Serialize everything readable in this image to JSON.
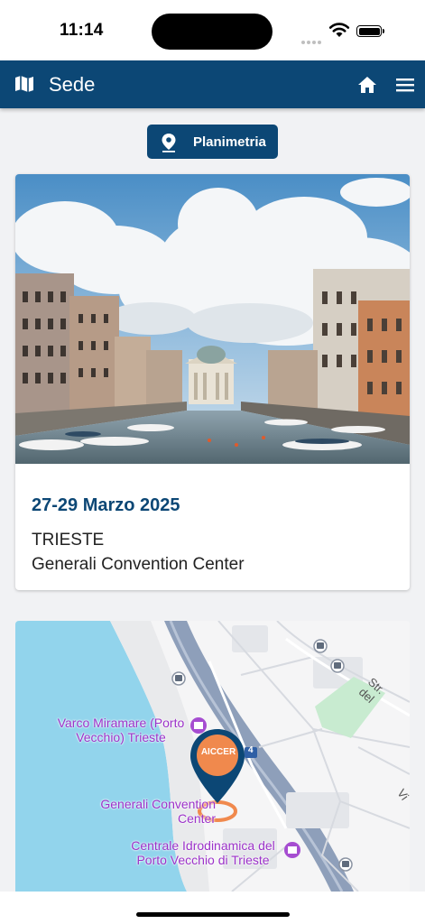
{
  "status_bar": {
    "time": "11:14"
  },
  "header": {
    "title": "Sede",
    "left_icon": "map-icon",
    "home_icon": "home-icon",
    "menu_icon": "menu-icon",
    "bg_color": "#0c4775"
  },
  "planimetria_button": {
    "label": "Planimetria",
    "icon": "location-pin-icon"
  },
  "event": {
    "dates": "27-29 Marzo 2025",
    "city": "TRIESTE",
    "venue": "Generali Convention Center",
    "accent_color": "#0c4775"
  },
  "map": {
    "labels": {
      "varco": "Varco Miramare (Porto Vecchio) Trieste",
      "generali": "Generali Convention Center",
      "centrale": "Centrale Idrodinamica del Porto Vecchio di Trieste",
      "street": "Str. del",
      "street_partial": "Vi",
      "road_number": "4"
    },
    "marker_logo": "AICCER",
    "poi_color": "#9c32c9",
    "marker_color": "#0c4775",
    "marker_logo_color": "#f0894d"
  }
}
